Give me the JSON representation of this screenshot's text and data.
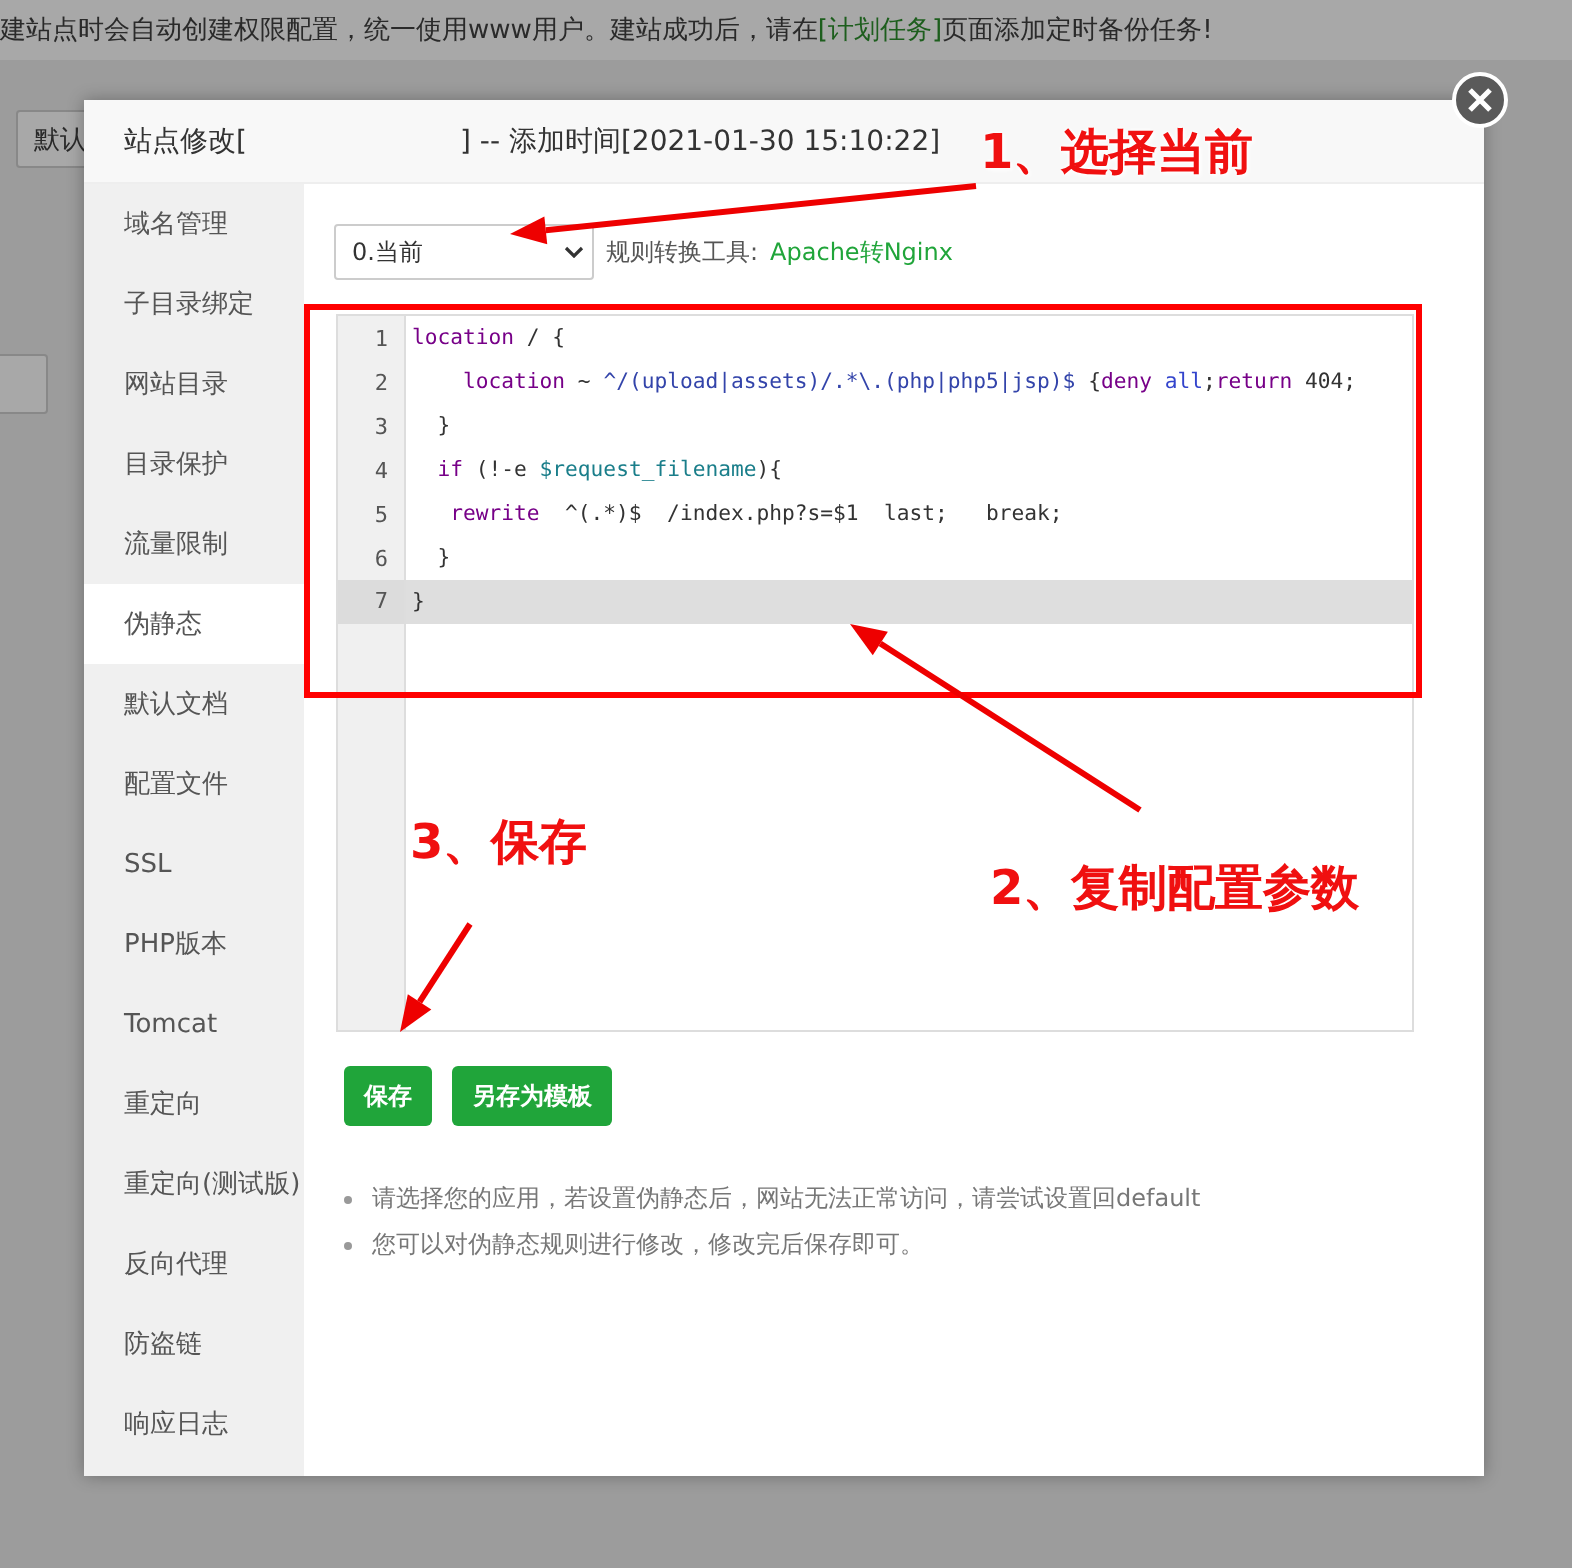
{
  "background": {
    "notice": {
      "before": "建站点时会自动创建权限配置，统一使用www用户。建站成功后，请在",
      "link": "[计划任务]",
      "after": "页面添加定时备份任务!"
    },
    "button": "默认"
  },
  "dialog": {
    "title": "站点修改[",
    "title_suffix": "] -- 添加时间[2021-01-30 15:10:22]",
    "sidebar": {
      "items": [
        {
          "label": "域名管理",
          "selected": false
        },
        {
          "label": "子目录绑定",
          "selected": false
        },
        {
          "label": "网站目录",
          "selected": false
        },
        {
          "label": "目录保护",
          "selected": false
        },
        {
          "label": "流量限制",
          "selected": false
        },
        {
          "label": "伪静态",
          "selected": true
        },
        {
          "label": "默认文档",
          "selected": false
        },
        {
          "label": "配置文件",
          "selected": false
        },
        {
          "label": "SSL",
          "selected": false
        },
        {
          "label": "PHP版本",
          "selected": false
        },
        {
          "label": "Tomcat",
          "selected": false
        },
        {
          "label": "重定向",
          "selected": false
        },
        {
          "label": "重定向(测试版)",
          "selected": false
        },
        {
          "label": "反向代理",
          "selected": false
        },
        {
          "label": "防盗链",
          "selected": false
        },
        {
          "label": "响应日志",
          "selected": false
        }
      ]
    },
    "template_select": {
      "value": "0.当前"
    },
    "tool_label": "规则转换工具:",
    "tool_link": "Apache转Nginx",
    "editor": {
      "lines": [
        {
          "number": "1",
          "active": false,
          "tokens": [
            {
              "kind": "keyword",
              "text": "location"
            },
            {
              "kind": "plain",
              "text": " / {"
            }
          ]
        },
        {
          "number": "2",
          "active": false,
          "tokens": [
            {
              "kind": "keyword",
              "text": "    location"
            },
            {
              "kind": "plain",
              "text": " ~ "
            },
            {
              "kind": "regex",
              "text": "^/(upload|assets)/.*\\.(php|php5|jsp)$"
            },
            {
              "kind": "plain",
              "text": " {"
            },
            {
              "kind": "keyword",
              "text": "deny"
            },
            {
              "kind": "atom",
              "text": " all"
            },
            {
              "kind": "plain",
              "text": ";"
            },
            {
              "kind": "keyword",
              "text": "return"
            },
            {
              "kind": "plain",
              "text": " 404;"
            }
          ]
        },
        {
          "number": "3",
          "active": false,
          "tokens": [
            {
              "kind": "plain",
              "text": "  }"
            }
          ]
        },
        {
          "number": "4",
          "active": false,
          "tokens": [
            {
              "kind": "keyword",
              "text": "  if"
            },
            {
              "kind": "plain",
              "text": " (!-e "
            },
            {
              "kind": "variable",
              "text": "$request_filename"
            },
            {
              "kind": "plain",
              "text": "){"
            }
          ]
        },
        {
          "number": "5",
          "active": false,
          "tokens": [
            {
              "kind": "keyword",
              "text": "   rewrite"
            },
            {
              "kind": "plain",
              "text": "  ^(.*)$  /index.php?s=$1  last;   break;"
            }
          ]
        },
        {
          "number": "6",
          "active": false,
          "tokens": [
            {
              "kind": "plain",
              "text": "  }"
            }
          ]
        },
        {
          "number": "7",
          "active": true,
          "tokens": [
            {
              "kind": "plain",
              "text": "}"
            }
          ]
        }
      ]
    },
    "buttons": [
      "保存",
      "另存为模板"
    ],
    "tips": [
      "请选择您的应用，若设置伪静态后，网站无法正常访问，请尝试设置回default",
      "您可以对伪静态规则进行修改，修改完后保存即可。"
    ]
  },
  "annotations": [
    "1、选择当前",
    "2、复制配置参数",
    "3、保存"
  ]
}
